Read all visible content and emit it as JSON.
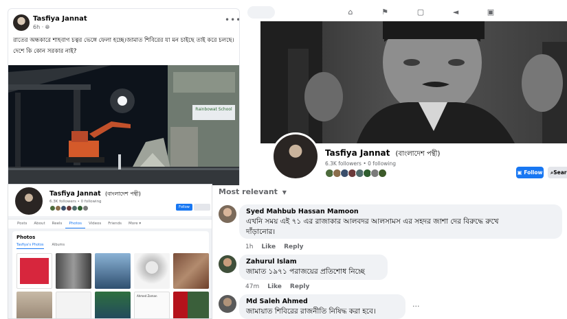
{
  "post": {
    "author": "Tasfiya Jannat",
    "time": "6h · ",
    "globe_icon": "globe-icon",
    "more_icon": "more-horizontal-icon",
    "text_line1": "রাতের অন্ধকারে শাহবাগ চত্বর ভেঙ্গে ফেলা হচ্ছে।জামাত শিবিরের যা মন চাইছে তাই করে চলছে।",
    "text_line2": "দেশে কি কোন সরকার নাই?",
    "photo_sign": "Rainbowat School"
  },
  "profile": {
    "nav_icons": [
      "home-icon",
      "flag-icon",
      "marketplace-icon",
      "megaphone-icon",
      "gaming-icon"
    ],
    "name": "Tasfiya Jannat",
    "name_suffix": "(বাংলাদেশ পন্থী)",
    "stats": "6.3K followers • 0 following",
    "follow_label": "Follow",
    "search_label": "Search"
  },
  "photos_panel": {
    "name": "Tasfiya Jannat",
    "name_suffix": "(বাংলাদেশ পন্থী)",
    "stats": "6.3K followers • 0 following",
    "follow_label": "Follow",
    "tabs": [
      "Posts",
      "About",
      "Reels",
      "Photos",
      "Videos",
      "Friends",
      "More ▾"
    ],
    "active_tab": "Photos",
    "section_title": "Photos",
    "photo_tabs": [
      "Tasfiya's Photos",
      "Albums"
    ],
    "thumb_caption": "Ahmed Zaman"
  },
  "comments": {
    "sort_label": "Most relevant",
    "items": [
      {
        "author": "Syed Mahbub Hassan Mamoon",
        "line1": "এখনি সময় এই ৭১ এর রাজাকার আলবদর আলসামস এর সহদর জাশা দের বিরুদ্ধে রুখে",
        "line2": "দাঁড়ানোর।",
        "time": "1h",
        "like": "Like",
        "reply": "Reply"
      },
      {
        "author": "Zahurul Islam",
        "line1": "জামাত ১৯৭১ পরাজয়ের প্রতিশোধ নিচ্ছে",
        "time": "47m",
        "like": "Like",
        "reply": "Reply"
      },
      {
        "author": "Md Saleh Ahmed",
        "line1": "জামায়াত শিবিরের রাজনীতি নিষিদ্ধ করা হবে।",
        "more": "···"
      }
    ]
  },
  "colors": {
    "brand_blue": "#1877f2",
    "secondary_text": "#65676b",
    "bubble_bg": "#f0f2f5"
  }
}
